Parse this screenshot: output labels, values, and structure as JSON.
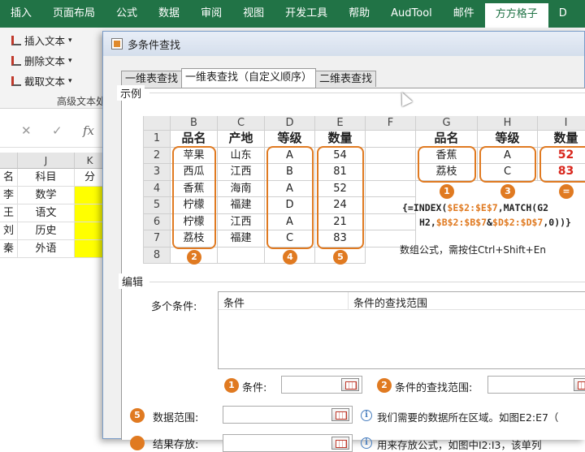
{
  "ribbon": {
    "tabs": [
      "插入",
      "页面布局",
      "公式",
      "数据",
      "审阅",
      "视图",
      "开发工具",
      "帮助",
      "AudTool",
      "邮件",
      "方方格子",
      "D"
    ],
    "active_tab": "方方格子",
    "buttons": [
      "插入文本",
      "删除文本",
      "截取文本"
    ],
    "group_label": "高级文本处"
  },
  "formula_bar": {
    "cancel": "✕",
    "enter": "✓",
    "fx": "fx"
  },
  "sheet": {
    "col_j": "J",
    "col_k": "K",
    "rows": [
      {
        "i": "名",
        "j": "科目",
        "k": "分"
      },
      {
        "i": "李",
        "j": "数学",
        "k": ""
      },
      {
        "i": "王",
        "j": "语文",
        "k": ""
      },
      {
        "i": "刘",
        "j": "历史",
        "k": ""
      },
      {
        "i": "秦",
        "j": "外语",
        "k": ""
      }
    ]
  },
  "dialog": {
    "title": "多条件查找",
    "tabs": [
      "一维表查找",
      "一维表查找（自定义顺序）",
      "二维表查找"
    ],
    "active_tab": 1,
    "example_label": "示例",
    "grid": {
      "cols": [
        "A",
        "B",
        "C",
        "D",
        "E",
        "F",
        "G",
        "H",
        "I"
      ],
      "rows": [
        "1",
        "2",
        "3",
        "4",
        "5",
        "6",
        "7",
        "8"
      ],
      "header": [
        "品名",
        "产地",
        "等级",
        "数量"
      ],
      "data": [
        [
          "苹果",
          "山东",
          "A",
          "54"
        ],
        [
          "西瓜",
          "江西",
          "B",
          "81"
        ],
        [
          "香蕉",
          "海南",
          "A",
          "52"
        ],
        [
          "柠檬",
          "福建",
          "D",
          "24"
        ],
        [
          "柠檬",
          "江西",
          "A",
          "21"
        ],
        [
          "荔枝",
          "福建",
          "C",
          "83"
        ]
      ],
      "result_header": [
        "品名",
        "等级",
        "数量"
      ],
      "result": [
        [
          "香蕉",
          "A",
          "52"
        ],
        [
          "荔枝",
          "C",
          "83"
        ]
      ]
    },
    "badges": [
      "2",
      "4",
      "5",
      "1",
      "3",
      "="
    ],
    "formula_line1_a": "{=INDEX(",
    "formula_line1_b": "$E$2:$E$7",
    "formula_line1_c": ",MATCH(G2",
    "formula_line2_a": "H2,",
    "formula_line2_b": "$B$2:$B$7",
    "formula_line2_c": "&",
    "formula_line2_d": "$D$2:$D$7",
    "formula_line2_e": ",0))}",
    "array_note": "数组公式，需按住Ctrl+Shift+En",
    "edit_label": "编辑",
    "multi_label": "多个条件:",
    "list_headers": [
      "条件",
      "条件的查找范围"
    ],
    "cond_label": "条件:",
    "cond_range_label": "条件的查找范围:",
    "data_range_label": "数据范围:",
    "data_range_note": "我们需要的数据所在区域。如图E2:E7（",
    "result_label": "结果存放:",
    "result_note": "用来存放公式，如图中I2:I3，该单列"
  }
}
